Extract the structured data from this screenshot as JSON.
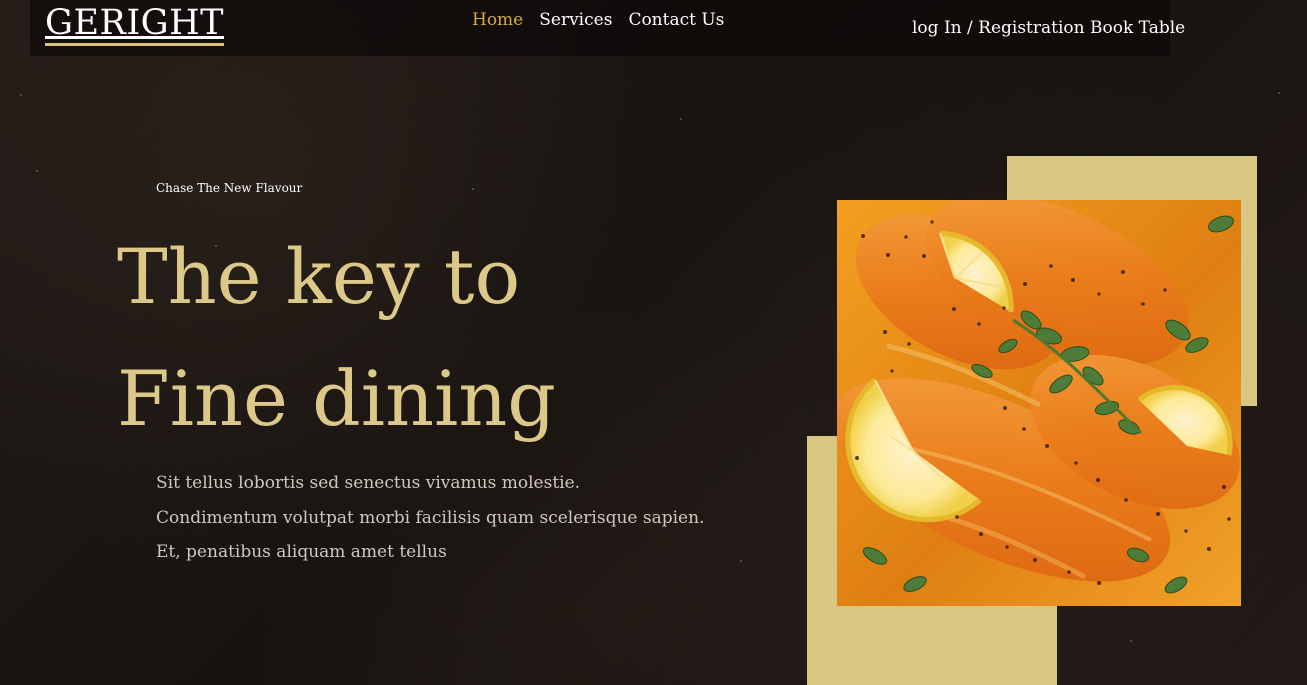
{
  "brand": {
    "name": "GERIGHT"
  },
  "nav": {
    "items": [
      {
        "label": "Home",
        "active": true
      },
      {
        "label": "Services",
        "active": false
      },
      {
        "label": "Contact Us",
        "active": false
      }
    ],
    "auth_label": "log In / Registration Book Table"
  },
  "hero": {
    "eyebrow": "Chase The New Flavour",
    "title_lines": [
      "The key to",
      "Fine dining"
    ],
    "body_lines": [
      "Sit tellus lobortis sed senectus vivamus molestie.",
      "Condimentum volutpat morbi facilisis quam scelerisque sapien.",
      "Et, penatibus aliquam amet tellus"
    ]
  },
  "colors": {
    "accent_gold": "#d8c783",
    "headline_gold": "#dcc98a",
    "active_nav": "#d8a845",
    "background": "#1b1613"
  },
  "image": {
    "subject": "salmon-dish-with-lemon-and-herbs"
  }
}
